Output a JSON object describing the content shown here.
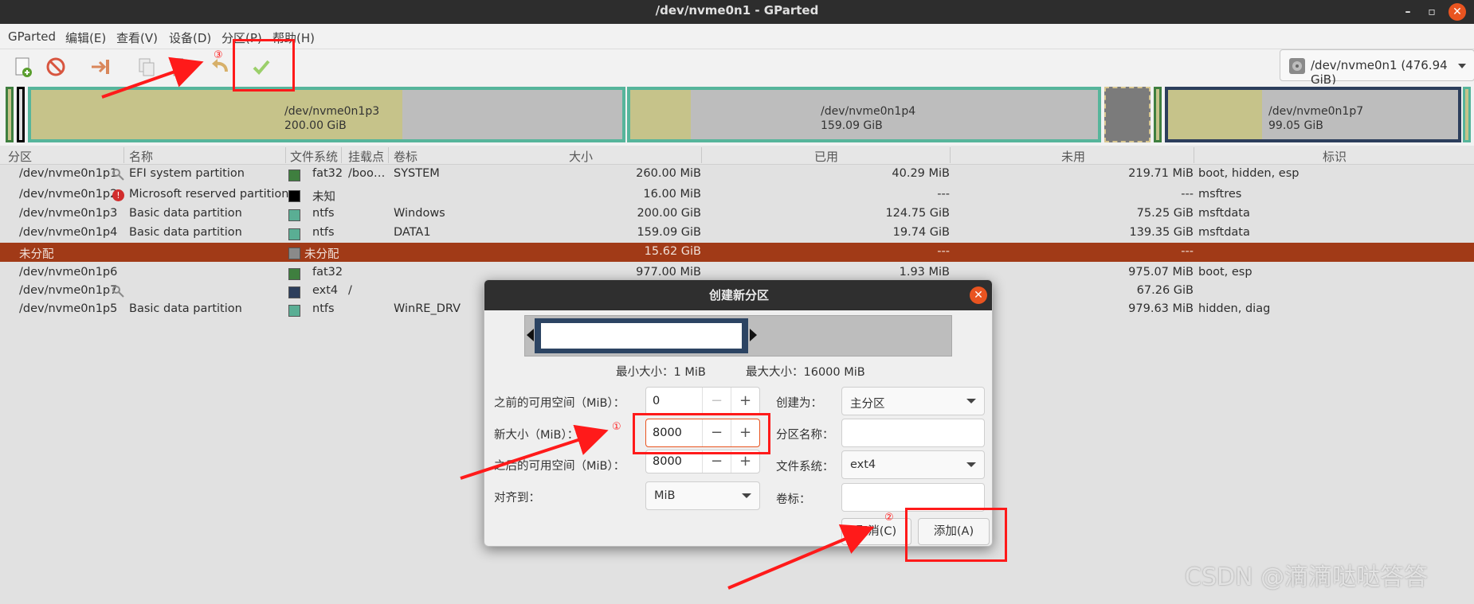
{
  "window": {
    "title": "/dev/nvme0n1 - GParted",
    "minimize": "–",
    "maximize": "▫",
    "close": "✕"
  },
  "menu": [
    "GParted",
    "编辑(E)",
    "查看(V)",
    "设备(D)",
    "分区(P)",
    "帮助(H)"
  ],
  "toolbar": {
    "icons": [
      "new-partition-icon",
      "delete-icon",
      "resize-move-icon",
      "copy-icon",
      "paste-icon",
      "undo-icon",
      "apply-icon"
    ],
    "device": "/dev/nvme0n1 (476.94 GiB)"
  },
  "graph": {
    "partitions": [
      {
        "name": "/dev/nvme0n1p3",
        "size": "200.00 GiB",
        "used_fraction": 0.62
      },
      {
        "name": "/dev/nvme0n1p4",
        "size": "159.09 GiB",
        "used_fraction": 0.12
      },
      {
        "name": "/dev/nvme0n1p7",
        "size": "99.05 GiB",
        "used_fraction": 0.32
      }
    ]
  },
  "table": {
    "headers": [
      "分区",
      "名称",
      "文件系统",
      "挂载点",
      "卷标",
      "大小",
      "已用",
      "未用",
      "标识"
    ],
    "rows": [
      {
        "partition": "/dev/nvme0n1p1",
        "icon": "key-icon",
        "name": "EFI system partition",
        "fs": "fat32",
        "fs_color": "#3f7f3f",
        "mount": "/boo…",
        "label": "SYSTEM",
        "size": "260.00 MiB",
        "used": "40.29 MiB",
        "unused": "219.71 MiB",
        "flags": "boot, hidden, esp"
      },
      {
        "partition": "/dev/nvme0n1p2",
        "icon": "warning-icon",
        "name": "Microsoft reserved partition",
        "fs": "未知",
        "fs_color": "#000000",
        "mount": "",
        "label": "",
        "size": "16.00 MiB",
        "used": "---",
        "unused": "---",
        "flags": "msftres"
      },
      {
        "partition": "/dev/nvme0n1p3",
        "icon": "",
        "name": "Basic data partition",
        "fs": "ntfs",
        "fs_color": "#5aae94",
        "mount": "",
        "label": "Windows",
        "size": "200.00 GiB",
        "used": "124.75 GiB",
        "unused": "75.25 GiB",
        "flags": "msftdata"
      },
      {
        "partition": "/dev/nvme0n1p4",
        "icon": "",
        "name": "Basic data partition",
        "fs": "ntfs",
        "fs_color": "#5aae94",
        "mount": "",
        "label": "DATA1",
        "size": "159.09 GiB",
        "used": "19.74 GiB",
        "unused": "139.35 GiB",
        "flags": "msftdata"
      },
      {
        "partition": "未分配",
        "icon": "",
        "name": "",
        "fs": "未分配",
        "fs_color": "#8a8a8a",
        "mount": "",
        "label": "",
        "size": "15.62 GiB",
        "used": "---",
        "unused": "---",
        "flags": "",
        "selected": true
      },
      {
        "partition": "/dev/nvme0n1p6",
        "icon": "",
        "name": "",
        "fs": "fat32",
        "fs_color": "#3f7f3f",
        "mount": "",
        "label": "",
        "size": "977.00 MiB",
        "used": "1.93 MiB",
        "unused": "975.07 MiB",
        "flags": "boot, esp"
      },
      {
        "partition": "/dev/nvme0n1p7",
        "icon": "key-icon",
        "name": "",
        "fs": "ext4",
        "fs_color": "#2c3e5c",
        "mount": "/",
        "label": "",
        "size": "",
        "used": "",
        "unused": "67.26 GiB",
        "flags": ""
      },
      {
        "partition": "/dev/nvme0n1p5",
        "icon": "",
        "name": "Basic data partition",
        "fs": "ntfs",
        "fs_color": "#5aae94",
        "mount": "",
        "label": "WinRE_DRV",
        "size": "",
        "used": "",
        "unused": "979.63 MiB",
        "flags": "hidden, diag"
      }
    ]
  },
  "dialog": {
    "title": "创建新分区",
    "min_size": "最小大小：1 MiB",
    "max_size": "最大大小：16000 MiB",
    "free_before_label": "之前的可用空间（MiB）：",
    "free_before_value": "0",
    "new_size_label": "新大小（MiB）：",
    "new_size_value": "8000",
    "free_after_label": "之后的可用空间（MiB）：",
    "free_after_value": "8000",
    "align_label": "对齐到：",
    "align_value": "MiB",
    "create_as_label": "创建为：",
    "create_as_value": "主分区",
    "partition_name_label": "分区名称：",
    "filesystem_label": "文件系统：",
    "filesystem_value": "ext4",
    "volume_label_label": "卷标：",
    "cancel_button": "取消(C)",
    "add_button": "添加(A)",
    "minus": "−",
    "plus": "+"
  },
  "annotations": {
    "n1": "①",
    "n2": "②",
    "n3": "③",
    "color": "#ff1a1a"
  },
  "watermark": "CSDN @滴滴哒哒答答"
}
